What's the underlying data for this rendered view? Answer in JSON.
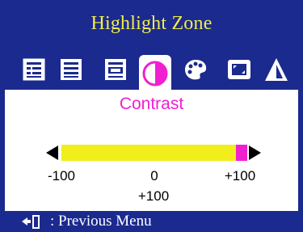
{
  "osd": {
    "title": "Highlight Zone",
    "menu_icons": [
      "zone-tile-icon",
      "zone-list-icon",
      "zone-window-icon",
      "contrast-icon",
      "color-palette-icon",
      "screen-size-icon",
      "sharpness-icon"
    ],
    "active_icon": "contrast-icon",
    "item_label": "Contrast",
    "slider": {
      "min_label": "-100",
      "mid_label": "0",
      "max_label": "+100",
      "value_label": "+100",
      "value": 100,
      "min": -100,
      "max": 100
    },
    "footer": {
      "icon": "previous-menu-icon",
      "separator": ":",
      "text": "Previous Menu",
      "full_text": ": Previous Menu"
    }
  },
  "colors": {
    "background": "#1b2a8e",
    "title": "#f2ee4a",
    "bar": "#f2ee1c",
    "highlight": "#f020d0",
    "panel": "#ffffff"
  }
}
